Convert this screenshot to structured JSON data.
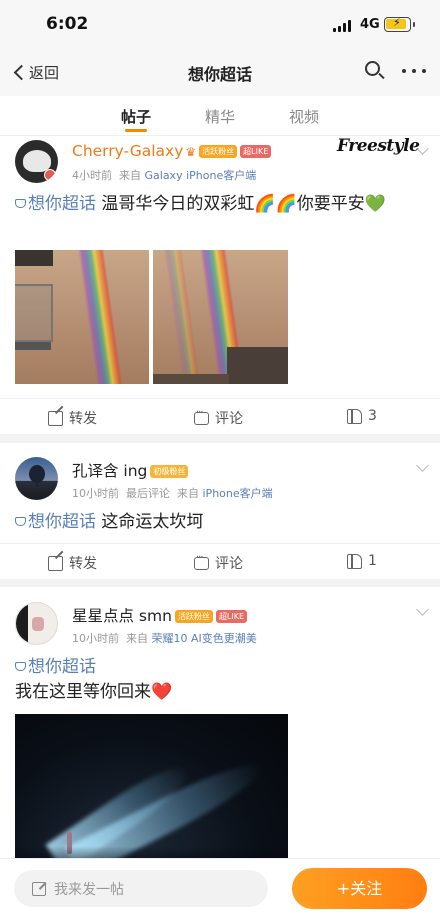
{
  "status": {
    "time": "6:02",
    "network": "4G"
  },
  "nav": {
    "back_label": "返回",
    "title": "想你超话"
  },
  "tabs": [
    {
      "label": "帖子"
    },
    {
      "label": "精华"
    },
    {
      "label": "视频"
    }
  ],
  "posts": [
    {
      "username": "Cherry-Galaxy",
      "badges": [
        "活跃粉丝",
        "超LIKE"
      ],
      "meta_time": "4小时前",
      "meta_from": "来自",
      "meta_source": "Galaxy iPhone客户端",
      "topic": "想你超话",
      "text": "温哥华今日的双彩虹🌈🌈你要平安💚",
      "overlay_text": "Freestyle",
      "share_label": "转发",
      "comment_label": "评论",
      "like_count": "3"
    },
    {
      "username": "孔译含 ing",
      "badges": [
        "初级粉丝"
      ],
      "meta_time": "10小时前",
      "meta_extra": "最后评论",
      "meta_from": "来自",
      "meta_source": "iPhone客户端",
      "topic": "想你超话",
      "text": "这命运太坎坷",
      "share_label": "转发",
      "comment_label": "评论",
      "like_count": "1"
    },
    {
      "username": "星星点点 smn",
      "badges": [
        "活跃粉丝",
        "超LIKE"
      ],
      "meta_time": "10小时前",
      "meta_from": "来自",
      "meta_source": "荣耀10 AI变色更潮美",
      "topic": "想你超话",
      "text": "我在这里等你回来❤️"
    }
  ],
  "bottom": {
    "compose_placeholder": "我来发一帖",
    "follow_label": "+关注"
  },
  "colors": {
    "accent": "#ff8200",
    "link": "#5a7fb8",
    "badge_orange": "#f6a623",
    "badge_red": "#e96a62"
  }
}
